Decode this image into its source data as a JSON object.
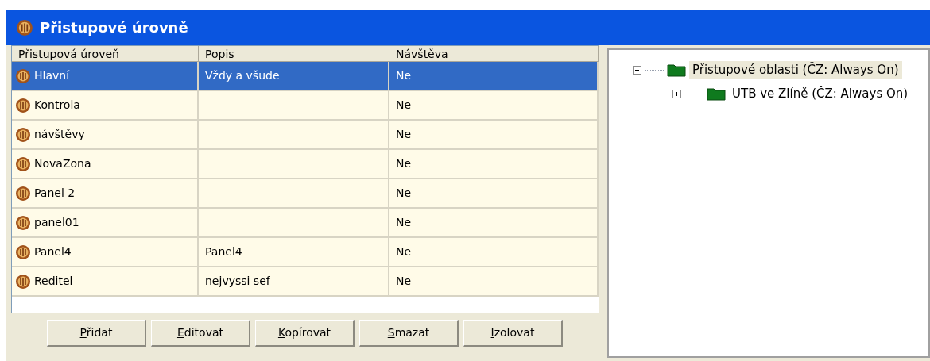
{
  "window": {
    "title": "Přistupové úrovně"
  },
  "table": {
    "columns": [
      "Přistupová úroveň",
      "Popis",
      "Návštěva"
    ],
    "rows": [
      {
        "name": "Hlavní",
        "popis": "Vždy a všude",
        "navsteva": "Ne",
        "selected": true
      },
      {
        "name": "Kontrola",
        "popis": "",
        "navsteva": "Ne",
        "selected": false
      },
      {
        "name": "návštěvy",
        "popis": "",
        "navsteva": "Ne",
        "selected": false
      },
      {
        "name": "NovaZona",
        "popis": "",
        "navsteva": "Ne",
        "selected": false
      },
      {
        "name": "Panel 2",
        "popis": "",
        "navsteva": "Ne",
        "selected": false
      },
      {
        "name": "panel01",
        "popis": "",
        "navsteva": "Ne",
        "selected": false
      },
      {
        "name": "Panel4",
        "popis": "Panel4",
        "navsteva": "Ne",
        "selected": false
      },
      {
        "name": "Reditel",
        "popis": "nejvyssi sef",
        "navsteva": "Ne",
        "selected": false
      }
    ]
  },
  "buttons": [
    "Přidat",
    "Editovat",
    "Kopírovat",
    "Smazat",
    "Izolovat"
  ],
  "tree": [
    {
      "label": "Přistupové oblasti (ČZ: Always On)",
      "expanded": true,
      "selected": true,
      "children": [
        {
          "label": "UTB ve Zlíně (ČZ: Always On)",
          "expanded": false,
          "selected": false
        }
      ]
    }
  ]
}
